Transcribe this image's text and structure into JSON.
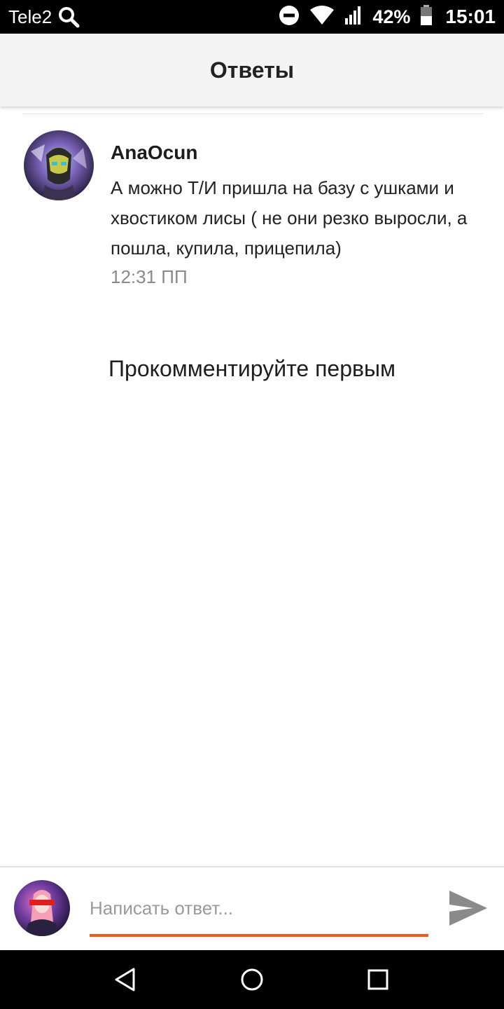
{
  "status_bar": {
    "carrier": "Tele2",
    "battery_percent": "42%",
    "time": "15:01",
    "icons": [
      "search-icon",
      "do-not-disturb-icon",
      "wifi-icon",
      "signal-icon",
      "battery-icon"
    ]
  },
  "header": {
    "title": "Ответы"
  },
  "comment": {
    "author": "AnaOcun",
    "text": "А можно Т/И пришла на базу с ушками и хвостиком лисы ( не они резко выросли, а пошла, купила, прицепила)",
    "time": "12:31 ПП"
  },
  "empty_state": {
    "text": "Прокомментируйте первым"
  },
  "reply": {
    "placeholder": "Написать ответ...",
    "value": ""
  },
  "colors": {
    "accent": "#f05a1e",
    "header_bg": "#f4f4f4",
    "time_text": "#8a8a8a",
    "send_icon": "#8a8a8a"
  },
  "nav": {
    "icons": [
      "back-icon",
      "home-icon",
      "recents-icon"
    ]
  }
}
